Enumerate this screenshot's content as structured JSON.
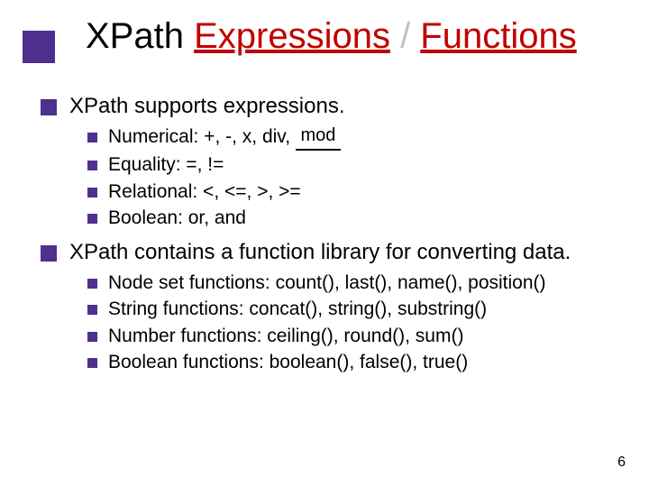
{
  "title": {
    "part1": "XPath ",
    "link1": "Expressions",
    "sep": " / ",
    "link2": "Functions"
  },
  "sections": [
    {
      "heading": "XPath supports expressions.",
      "items": [
        {
          "prefix": "Numerical: +, -, x, div, ",
          "blankAbove": "mod"
        },
        {
          "prefix": "Equality: =,  !="
        },
        {
          "prefix": "Relational: <, <=, >, >="
        },
        {
          "prefix": "Boolean: or, and"
        }
      ]
    },
    {
      "heading": "XPath contains a function library for converting data.",
      "items": [
        {
          "prefix": "Node set functions: count(), last(), name(), position()"
        },
        {
          "prefix": "String functions: concat(), string(), substring()"
        },
        {
          "prefix": "Number functions: ceiling(), round(), sum()"
        },
        {
          "prefix": "Boolean functions: boolean(), false(), true()"
        }
      ]
    }
  ],
  "pageNumber": "6"
}
